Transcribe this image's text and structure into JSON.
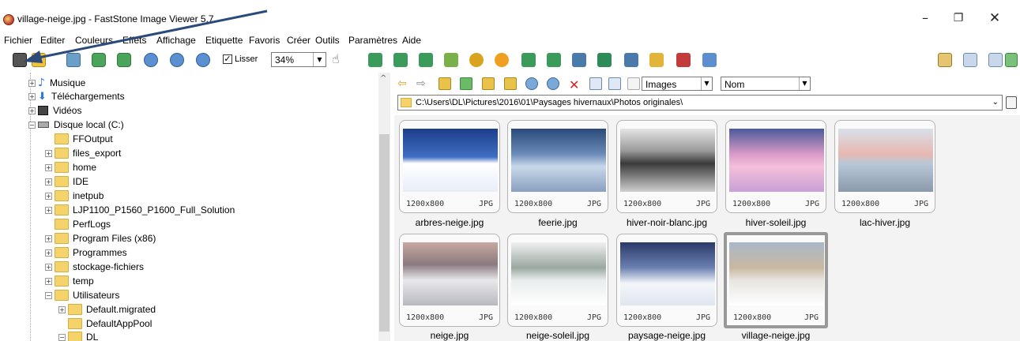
{
  "window": {
    "title": "village-neige.jpg  -  FastStone Image Viewer 5.7",
    "min": "–",
    "max": "❐",
    "close": "✕"
  },
  "menu": [
    "Fichier",
    "Editer",
    "Couleurs",
    "Effets",
    "Affichage",
    "Etiquette",
    "Favoris",
    "Créer",
    "Outils",
    "Paramètres",
    "Aide"
  ],
  "toolbar": {
    "smooth_label": "Lisser",
    "smooth_checked": "✓",
    "zoom": "34%"
  },
  "tree": [
    {
      "label": "Musique",
      "icon": "music-icon"
    },
    {
      "label": "Téléchargements",
      "icon": "download-icon"
    },
    {
      "label": "Vidéos",
      "icon": "video-icon"
    },
    {
      "label": "Disque local (C:)",
      "icon": "drive-icon"
    },
    {
      "label": "FFOutput"
    },
    {
      "label": "files_export"
    },
    {
      "label": "home"
    },
    {
      "label": "IDE"
    },
    {
      "label": "inetpub"
    },
    {
      "label": "LJP1100_P1560_P1600_Full_Solution"
    },
    {
      "label": "PerfLogs"
    },
    {
      "label": "Program Files (x86)"
    },
    {
      "label": "Programmes"
    },
    {
      "label": "stockage-fichiers"
    },
    {
      "label": "temp"
    },
    {
      "label": "Utilisateurs"
    },
    {
      "label": "Default.migrated"
    },
    {
      "label": "DefaultAppPool"
    },
    {
      "label": "DL"
    }
  ],
  "browser": {
    "filter": "Images",
    "sort": "Nom",
    "path": "C:\\Users\\DL\\Pictures\\2016\\01\\Paysages hivernaux\\Photos originales\\"
  },
  "thumbnails": [
    {
      "name": "arbres-neige.jpg",
      "dims": "1200x800",
      "type": "JPG"
    },
    {
      "name": "feerie.jpg",
      "dims": "1200x800",
      "type": "JPG"
    },
    {
      "name": "hiver-noir-blanc.jpg",
      "dims": "1200x800",
      "type": "JPG"
    },
    {
      "name": "hiver-soleil.jpg",
      "dims": "1200x800",
      "type": "JPG"
    },
    {
      "name": "lac-hiver.jpg",
      "dims": "1200x800",
      "type": "JPG"
    },
    {
      "name": "neige.jpg",
      "dims": "1200x800",
      "type": "JPG"
    },
    {
      "name": "neige-soleil.jpg",
      "dims": "1200x800",
      "type": "JPG"
    },
    {
      "name": "paysage-neige.jpg",
      "dims": "1200x800",
      "type": "JPG"
    },
    {
      "name": "village-neige.jpg",
      "dims": "1200x800",
      "type": "JPG"
    }
  ],
  "colors": {
    "folder": "#f5d36b",
    "selection_border": "#999999",
    "annotation_arrow": "#2a4a7a"
  }
}
